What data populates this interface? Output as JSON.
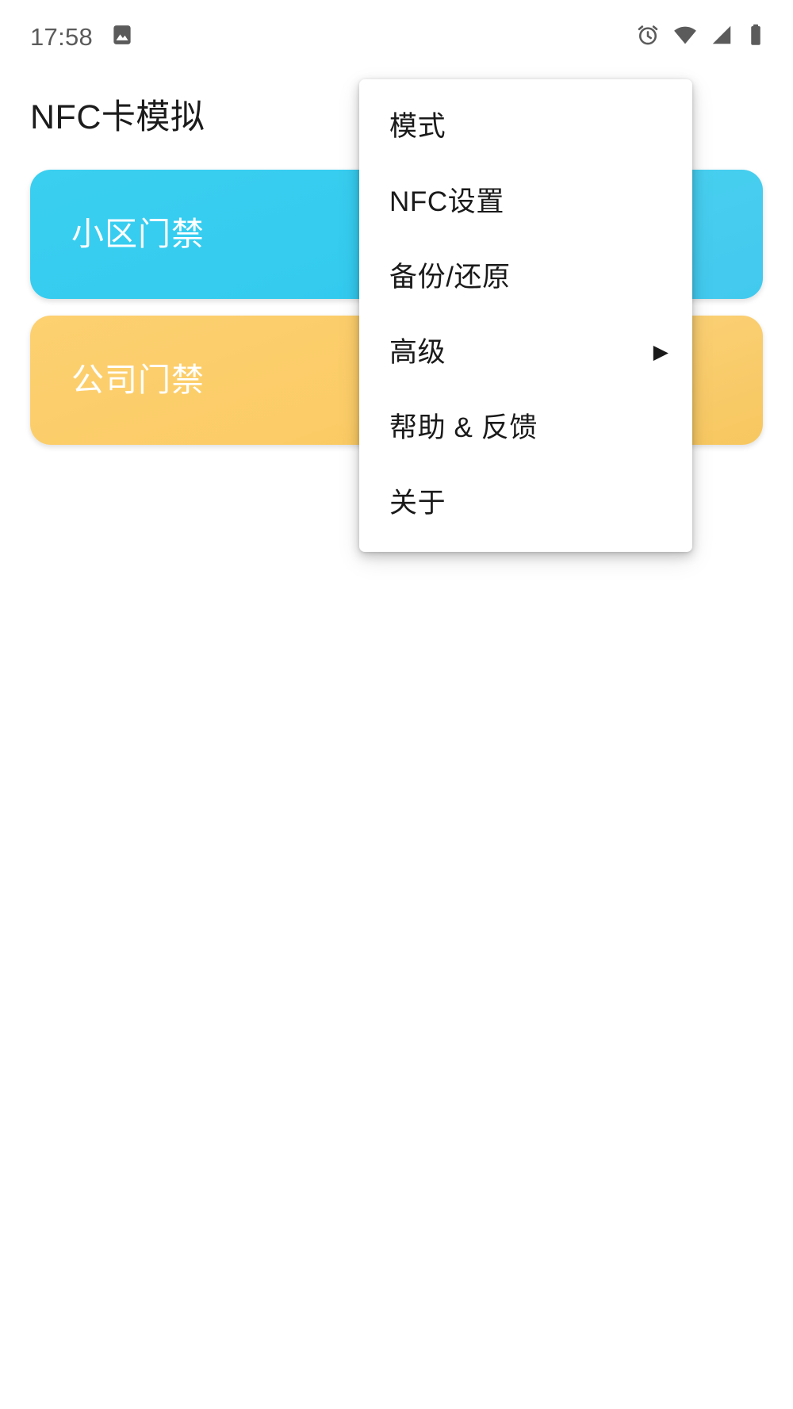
{
  "status_bar": {
    "time": "17:58",
    "left_icons": [
      {
        "name": "gallery-icon",
        "glyph": "image"
      }
    ],
    "right_icons": [
      {
        "name": "alarm-clock-icon",
        "glyph": "alarm"
      },
      {
        "name": "wifi-icon",
        "glyph": "wifi"
      },
      {
        "name": "cellular-signal-icon",
        "glyph": "signal"
      },
      {
        "name": "battery-icon",
        "glyph": "battery"
      }
    ],
    "text_color": "#5b5b5b"
  },
  "app": {
    "title": "NFC卡模拟"
  },
  "cards": [
    {
      "label": "小区门禁",
      "color": "#3ACFF0",
      "color_end": "#2FC6EC",
      "text_color": "#ffffff"
    },
    {
      "label": "公司门禁",
      "color": "#FBCC67",
      "color_end": "#F8C352",
      "text_color": "#ffffff"
    }
  ],
  "menu": {
    "items": [
      {
        "label": "模式",
        "has_submenu": false,
        "arrow": ""
      },
      {
        "label": "NFC设置",
        "has_submenu": false,
        "arrow": ""
      },
      {
        "label": "备份/还原",
        "has_submenu": false,
        "arrow": ""
      },
      {
        "label": "高级",
        "has_submenu": true,
        "arrow": "▶"
      },
      {
        "label": "帮助 & 反馈",
        "has_submenu": false,
        "arrow": ""
      },
      {
        "label": "关于",
        "has_submenu": false,
        "arrow": ""
      }
    ],
    "background": "#ffffff",
    "text_color": "#1a1a1a"
  }
}
